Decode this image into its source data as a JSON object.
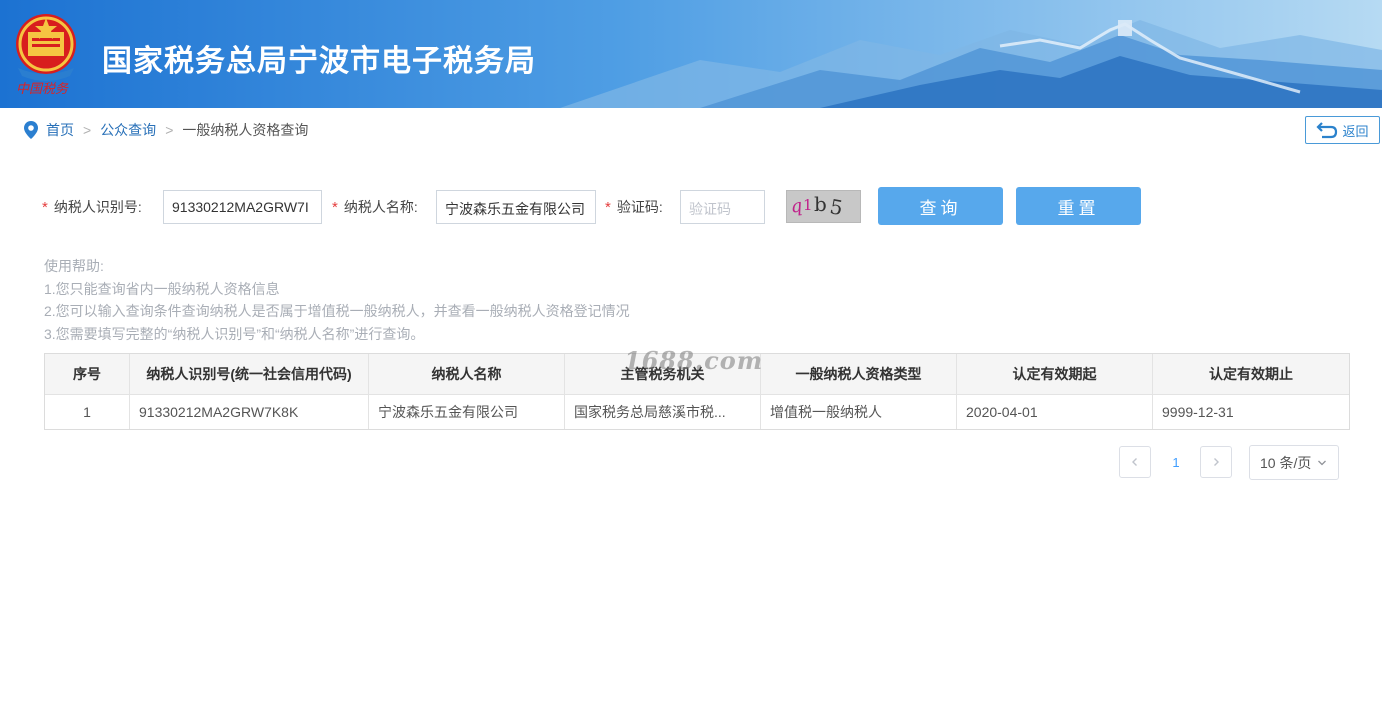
{
  "header": {
    "title": "国家税务总局宁波市电子税务局",
    "emblem_caption": "中国税务"
  },
  "breadcrumb": {
    "items": [
      "首页",
      "公众查询",
      "一般纳税人资格查询"
    ],
    "separator": ">"
  },
  "back_button": {
    "label": "返回"
  },
  "form": {
    "taxpayer_id": {
      "label": "纳税人识别号:",
      "value": "91330212MA2GRW7K8K",
      "display": "91330212MA2GRW7I"
    },
    "taxpayer_name": {
      "label": "纳税人名称:",
      "value": "宁波森乐五金有限公司",
      "display": "宁波森乐五金有限公司"
    },
    "captcha": {
      "label": "验证码:",
      "placeholder": "验证码",
      "image_text": "q1b5"
    },
    "required_mark": "*",
    "query_button": "查询",
    "reset_button": "重置"
  },
  "help": {
    "title": "使用帮助:",
    "lines": [
      "1.您只能查询省内一般纳税人资格信息",
      "2.您可以输入查询条件查询纳税人是否属于增值税一般纳税人，并查看一般纳税人资格登记情况",
      "3.您需要填写完整的“纳税人识别号”和“纳税人名称”进行查询。"
    ]
  },
  "table": {
    "headers": [
      "序号",
      "纳税人识别号(统一社会信用代码)",
      "纳税人名称",
      "主管税务机关",
      "一般纳税人资格类型",
      "认定有效期起",
      "认定有效期止"
    ],
    "rows": [
      [
        "1",
        "91330212MA2GRW7K8K",
        "宁波森乐五金有限公司",
        "国家税务总局慈溪市税...",
        "增值税一般纳税人",
        "2020-04-01",
        "9999-12-31"
      ]
    ]
  },
  "watermark": "1688.com",
  "pagination": {
    "current_page": "1",
    "page_size": "10 条/页"
  },
  "colors": {
    "header_start": "#1e78d6",
    "primary_button": "#57a8ec",
    "link": "#2870b8",
    "required": "#e53e3e"
  }
}
